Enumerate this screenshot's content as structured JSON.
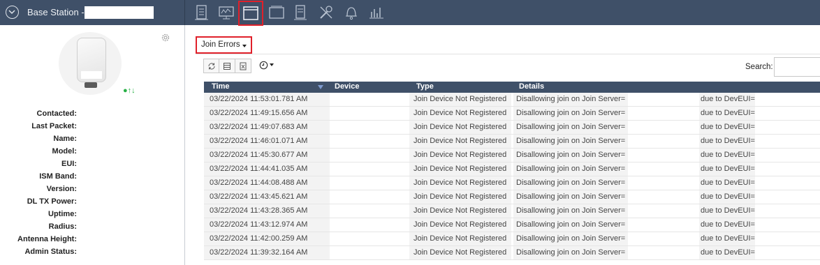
{
  "header": {
    "title": "Base Station -",
    "toolbar_icons": [
      "gateway-icon",
      "monitor-chart-icon",
      "window-icon",
      "panel-icon",
      "document-icon",
      "tools-icon",
      "bell-icon",
      "bar-chart-icon"
    ],
    "active_icon": "window-icon",
    "highlight_color": "#e0202a",
    "bar_color": "#3f5068"
  },
  "sidebar": {
    "status_indicators": "●↑↓",
    "fields": [
      "Contacted:",
      "Last Packet:",
      "Name:",
      "Model:",
      "EUI:",
      "ISM Band:",
      "Version:",
      "DL TX Power:",
      "Uptime:",
      "Radius:",
      "Antenna Height:",
      "Admin Status:"
    ]
  },
  "main": {
    "dropdown_label": "Join Errors",
    "search_label": "Search:",
    "search_value": "",
    "table": {
      "columns": [
        "Time",
        "Device",
        "Type",
        "Details"
      ],
      "rows": [
        {
          "time": "03/22/2024 11:53:01.781 AM",
          "device": "",
          "type": "Join Device Not Registered",
          "details_1": "Disallowing join on Join Server=",
          "details_2": "due to DevEUI="
        },
        {
          "time": "03/22/2024 11:49:15.656 AM",
          "device": "",
          "type": "Join Device Not Registered",
          "details_1": "Disallowing join on Join Server=",
          "details_2": "due to DevEUI="
        },
        {
          "time": "03/22/2024 11:49:07.683 AM",
          "device": "",
          "type": "Join Device Not Registered",
          "details_1": "Disallowing join on Join Server=",
          "details_2": "due to DevEUI="
        },
        {
          "time": "03/22/2024 11:46:01.071 AM",
          "device": "",
          "type": "Join Device Not Registered",
          "details_1": "Disallowing join on Join Server=",
          "details_2": "due to DevEUI="
        },
        {
          "time": "03/22/2024 11:45:30.677 AM",
          "device": "",
          "type": "Join Device Not Registered",
          "details_1": "Disallowing join on Join Server=",
          "details_2": "due to DevEUI="
        },
        {
          "time": "03/22/2024 11:44:41.035 AM",
          "device": "",
          "type": "Join Device Not Registered",
          "details_1": "Disallowing join on Join Server=",
          "details_2": "due to DevEUI="
        },
        {
          "time": "03/22/2024 11:44:08.488 AM",
          "device": "",
          "type": "Join Device Not Registered",
          "details_1": "Disallowing join on Join Server=",
          "details_2": "due to DevEUI="
        },
        {
          "time": "03/22/2024 11:43:45.621 AM",
          "device": "",
          "type": "Join Device Not Registered",
          "details_1": "Disallowing join on Join Server=",
          "details_2": "due to DevEUI="
        },
        {
          "time": "03/22/2024 11:43:28.365 AM",
          "device": "",
          "type": "Join Device Not Registered",
          "details_1": "Disallowing join on Join Server=",
          "details_2": "due to DevEUI="
        },
        {
          "time": "03/22/2024 11:43:12.974 AM",
          "device": "",
          "type": "Join Device Not Registered",
          "details_1": "Disallowing join on Join Server=",
          "details_2": "due to DevEUI="
        },
        {
          "time": "03/22/2024 11:42:00.259 AM",
          "device": "",
          "type": "Join Device Not Registered",
          "details_1": "Disallowing join on Join Server=",
          "details_2": "due to DevEUI="
        },
        {
          "time": "03/22/2024 11:39:32.164 AM",
          "device": "",
          "type": "Join Device Not Registered",
          "details_1": "Disallowing join on Join Server=",
          "details_2": "due to DevEUI="
        }
      ]
    }
  }
}
